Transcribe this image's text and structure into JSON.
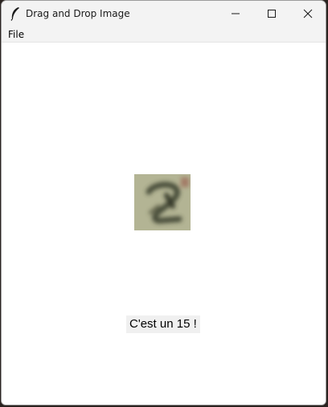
{
  "window": {
    "title": "Drag and Drop Image",
    "app_icon": "feather-icon",
    "controls": [
      "minimize-icon",
      "maximize-icon",
      "close-icon"
    ]
  },
  "menubar": {
    "items": [
      "File"
    ]
  },
  "main": {
    "image": {
      "description_icon": "digit-image-thumbnail"
    },
    "result_text": "C'est un 15 !"
  }
}
